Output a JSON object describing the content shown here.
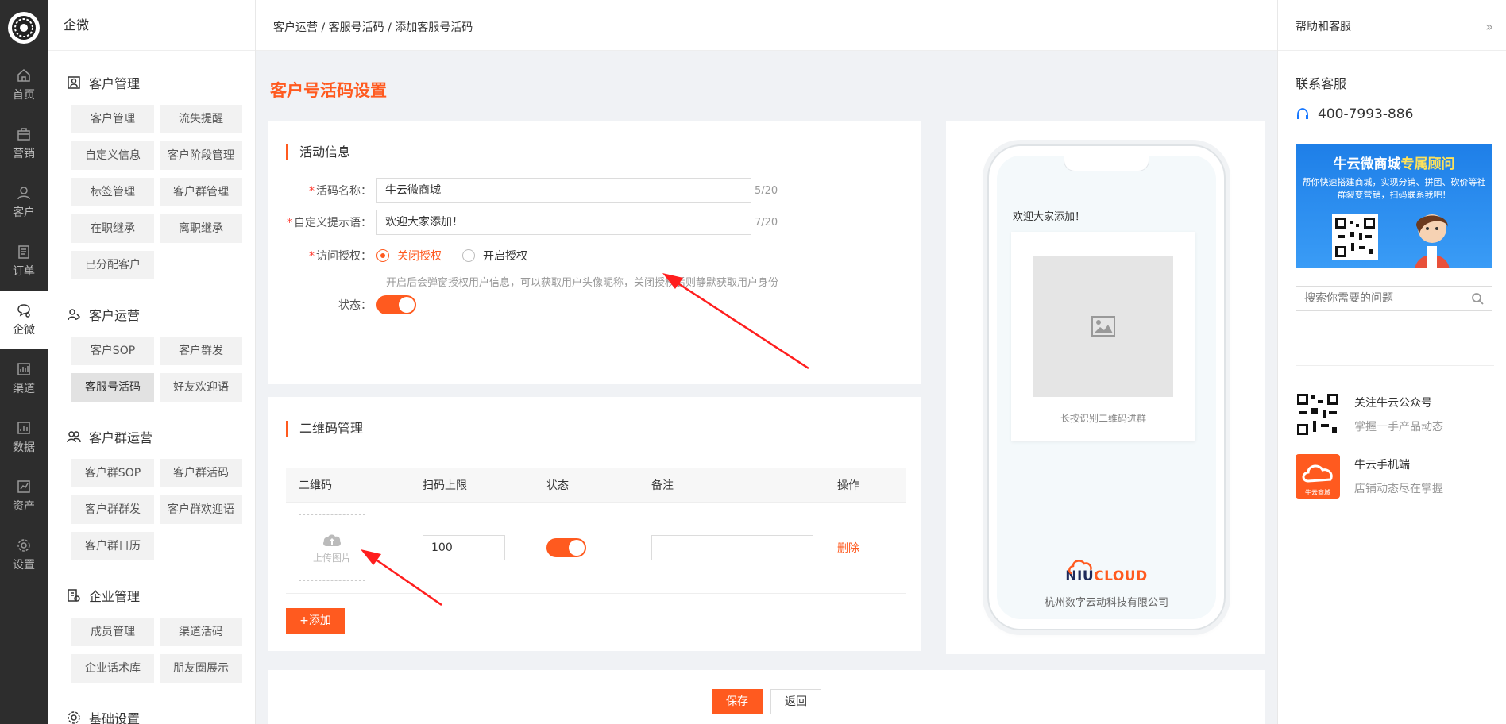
{
  "rail": {
    "items": [
      {
        "label": "首页",
        "icon": "home-icon"
      },
      {
        "label": "营销",
        "icon": "marketing-icon"
      },
      {
        "label": "客户",
        "icon": "customer-icon"
      },
      {
        "label": "订单",
        "icon": "order-icon"
      },
      {
        "label": "企微",
        "icon": "wecom-icon",
        "active": true
      },
      {
        "label": "渠道",
        "icon": "channel-icon"
      },
      {
        "label": "数据",
        "icon": "data-icon"
      },
      {
        "label": "资产",
        "icon": "asset-icon"
      },
      {
        "label": "设置",
        "icon": "settings-icon"
      }
    ]
  },
  "submenu": {
    "title": "企微",
    "groups": [
      {
        "title": "客户管理",
        "items": [
          "客户管理",
          "流失提醒",
          "自定义信息",
          "客户阶段管理",
          "标签管理",
          "客户群管理",
          "在职继承",
          "离职继承",
          "已分配客户"
        ]
      },
      {
        "title": "客户运营",
        "items": [
          "客户SOP",
          "客户群发",
          "客服号活码",
          "好友欢迎语"
        ]
      },
      {
        "title": "客户群运营",
        "items": [
          "客户群SOP",
          "客户群活码",
          "客户群群发",
          "客户群欢迎语",
          "客户群日历"
        ]
      },
      {
        "title": "企业管理",
        "items": [
          "成员管理",
          "渠道活码",
          "企业话术库",
          "朋友圈展示"
        ]
      },
      {
        "title": "基础设置",
        "items": []
      }
    ]
  },
  "breadcrumb": "客户运营 / 客服号活码 / 添加客服号活码",
  "page_title": "客户号活码设置",
  "info": {
    "section_title": "活动信息",
    "name_label": "活码名称：",
    "name_value": "牛云微商城",
    "name_counter": "5/20",
    "tip_label": "自定义提示语：",
    "tip_value": "欢迎大家添加！",
    "tip_counter": "7/20",
    "auth_label": "访问授权：",
    "auth_off": "关闭授权",
    "auth_on": "开启授权",
    "auth_hint": "开启后会弹窗授权用户信息，可以获取用户头像昵称，关闭授权后则静默获取用户身份",
    "status_label": "状态："
  },
  "qr": {
    "section_title": "二维码管理",
    "columns": [
      "二维码",
      "扫码上限",
      "状态",
      "备注",
      "操作"
    ],
    "rows": [
      {
        "upload_label": "上传图片",
        "limit": "100",
        "remark": "",
        "action": "删除"
      }
    ],
    "add_label": "+添加"
  },
  "preview": {
    "welcome": "欢迎大家添加！",
    "qr_caption": "长按识别二维码进群",
    "brand_a": "NIU",
    "brand_b": "CLOUD",
    "company": "杭州数字云动科技有限公司"
  },
  "footer": {
    "save": "保存",
    "back": "返回"
  },
  "help": {
    "title": "帮助和客服",
    "collapse": "»",
    "contact_title": "联系客服",
    "phone": "400-7993-886",
    "banner_title_a": "牛云微商城",
    "banner_title_b": "专属顾问",
    "banner_sub": "帮你快速搭建商城，实现分销、拼团、砍价等社群裂变营销，扫码联系我吧！",
    "search_placeholder": "搜索你需要的问题",
    "feature1_title": "关注牛云公众号",
    "feature1_sub": "掌握一手产品动态",
    "feature2_title": "牛云手机端",
    "feature2_sub": "店铺动态尽在掌握",
    "feature2_badge": "牛云商城",
    "accent": "#ff5a1f"
  }
}
